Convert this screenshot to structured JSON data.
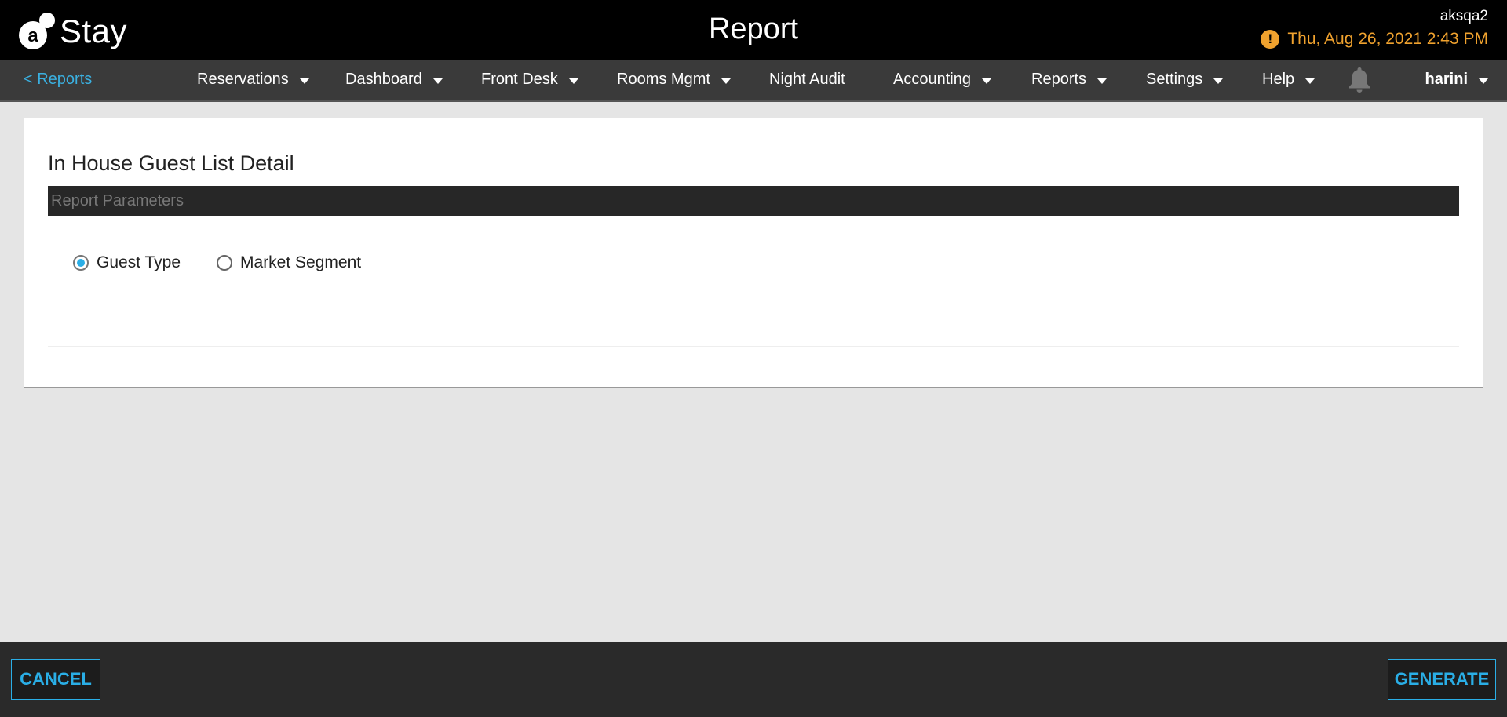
{
  "header": {
    "logo_letter": "a",
    "logo_text": "Stay",
    "title": "Report",
    "account": "aksqa2",
    "datetime": "Thu, Aug 26, 2021 2:43 PM",
    "warning_glyph": "!"
  },
  "nav": {
    "back_label": "< Reports",
    "items": [
      {
        "label": "Reservations",
        "has_dropdown": true
      },
      {
        "label": "Dashboard",
        "has_dropdown": true
      },
      {
        "label": "Front Desk",
        "has_dropdown": true
      },
      {
        "label": "Rooms Mgmt",
        "has_dropdown": true
      },
      {
        "label": "Night Audit",
        "has_dropdown": false
      },
      {
        "label": "Accounting",
        "has_dropdown": true
      },
      {
        "label": "Reports",
        "has_dropdown": true
      },
      {
        "label": "Settings",
        "has_dropdown": true
      },
      {
        "label": "Help",
        "has_dropdown": true
      }
    ],
    "user": "harini"
  },
  "report": {
    "title": "In House Guest List Detail",
    "params_header": "Report Parameters",
    "options": [
      {
        "label": "Guest Type",
        "checked": true
      },
      {
        "label": "Market Segment",
        "checked": false
      }
    ]
  },
  "footer": {
    "cancel_label": "CANCEL",
    "generate_label": "GENERATE"
  },
  "colors": {
    "accent": "#2aaee6",
    "warning": "#f0a22e",
    "topbar_bg": "#000000",
    "navbar_bg": "#3a3a3a",
    "footer_bg": "#2a2a2a"
  }
}
